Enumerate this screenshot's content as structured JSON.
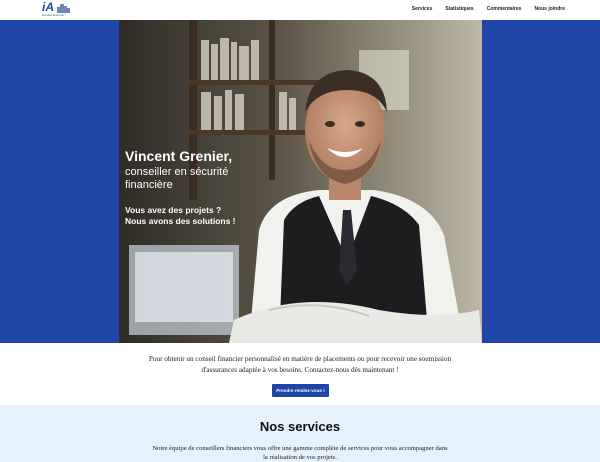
{
  "header": {
    "logo": {
      "mark": "iA",
      "subtitle": "Groupe financier"
    },
    "nav": [
      "Services",
      "Statistiques",
      "Commentaires",
      "Nous joindre"
    ]
  },
  "hero": {
    "name": "Vincent Grenier,",
    "role": "conseiller en sécurité financière",
    "tagline_1": "Vous avez des projets ?",
    "tagline_2": "Nous avons des solutions !",
    "background_color": "#1f45a8"
  },
  "intro": {
    "text": "Pour obtenir un conseil financier personnalisé en matière de placements ou pour recevoir une soumission d'assurances adaptée à vos besoins. Contactez-nous dès maintenant !",
    "cta_label": "Prendre rendez-vous !"
  },
  "services": {
    "title": "Nos services",
    "text": "Notre équipe de conseillers financiers vous offre une gamme complète de services pour vous accompagner dans la réalisation de vos projets."
  }
}
